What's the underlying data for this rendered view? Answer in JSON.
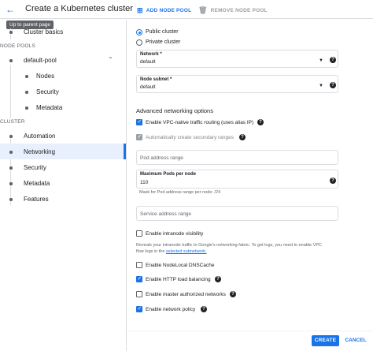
{
  "header": {
    "title": "Create a Kubernetes cluster",
    "add_node_pool": "ADD NODE POOL",
    "remove_node_pool": "REMOVE NODE POOL",
    "tooltip": "Up to parent page"
  },
  "sidebar": {
    "cluster_basics": "Cluster basics",
    "node_pools_section": "NODE POOLS",
    "default_pool": "default-pool",
    "nodes": "Nodes",
    "security_pool": "Security",
    "metadata_pool": "Metadata",
    "cluster_section": "CLUSTER",
    "automation": "Automation",
    "networking": "Networking",
    "security": "Security",
    "metadata": "Metadata",
    "features": "Features"
  },
  "main": {
    "public_cluster": "Public cluster",
    "private_cluster": "Private cluster",
    "network_label": "Network *",
    "network_value": "default",
    "subnet_label": "Node subnet *",
    "subnet_value": "default",
    "adv_heading": "Advanced networking options",
    "vpc_native": "Enable VPC-native traffic routing (uses alias IP)",
    "auto_secondary": "Automatically create secondary ranges",
    "pod_range_placeholder": "Pod address range",
    "max_pods_label": "Maximum Pods per node",
    "max_pods_value": "110",
    "max_pods_hint": "Mask for Pod address range per node: /24",
    "service_range_placeholder": "Service address range",
    "intranode": "Enable intranode visibility",
    "intranode_hint_1": "Reveals your intranode traffic to Google's networking fabric. To get logs, you need to enable VPC",
    "intranode_hint_2": "flow logs in the",
    "intranode_link": "selected subnetwork.",
    "nodelocal_dns": "Enable NodeLocal DNSCache",
    "http_lb": "Enable HTTP load balancing",
    "master_auth": "Enable master authorized networks",
    "network_policy": "Enable network policy"
  },
  "footer": {
    "create": "CREATE",
    "cancel": "CANCEL"
  },
  "colors": {
    "accent": "#1a73e8",
    "active_bg": "#e8f0fe",
    "border": "#dadce0"
  }
}
